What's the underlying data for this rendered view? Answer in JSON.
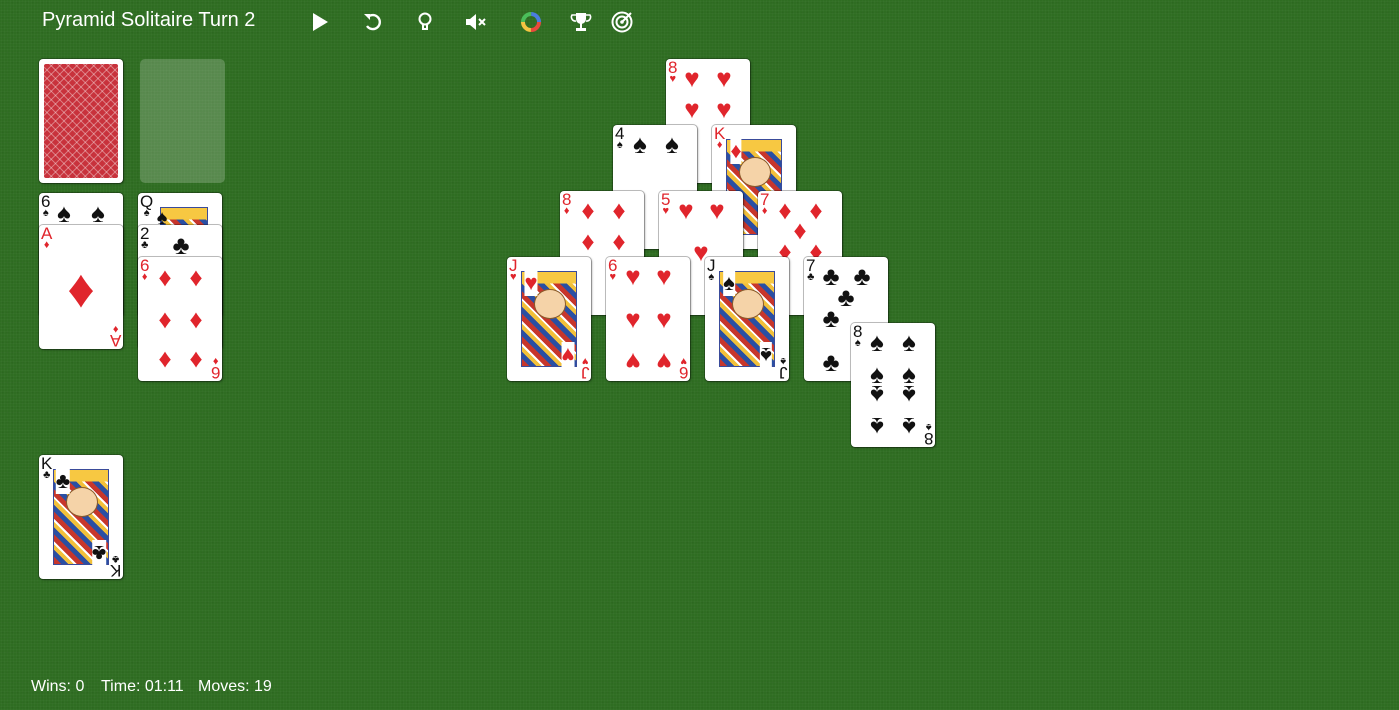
{
  "title": "Pyramid Solitaire Turn 2",
  "toolbar": [
    {
      "name": "play-icon"
    },
    {
      "name": "undo-icon"
    },
    {
      "name": "hint-bulb-icon"
    },
    {
      "name": "mute-icon"
    },
    {
      "name": "color-wheel-icon"
    },
    {
      "name": "trophy-icon"
    },
    {
      "name": "target-icon"
    }
  ],
  "colors": {
    "felt": "#2f6d22",
    "red": "#e0252c",
    "black": "#111111",
    "card_back": "#c8323c"
  },
  "stock": {
    "face_down": true
  },
  "waste": {
    "empty": true
  },
  "pyramid": [
    {
      "rank": "8",
      "suit": "♥",
      "color": "red"
    },
    {
      "rank": "4",
      "suit": "♠",
      "color": "black"
    },
    {
      "rank": "K",
      "suit": "♦",
      "color": "red"
    },
    {
      "rank": "8",
      "suit": "♦",
      "color": "red"
    },
    {
      "rank": "5",
      "suit": "♥",
      "color": "red"
    },
    {
      "rank": "7",
      "suit": "♦",
      "color": "red"
    },
    {
      "rank": "J",
      "suit": "♥",
      "color": "red"
    },
    {
      "rank": "6",
      "suit": "♥",
      "color": "red"
    },
    {
      "rank": "J",
      "suit": "♠",
      "color": "black"
    },
    {
      "rank": "7",
      "suit": "♣",
      "color": "black"
    },
    {
      "rank": "8",
      "suit": "♠",
      "color": "black"
    }
  ],
  "left_columns": [
    {
      "rank": "6",
      "suit": "♠",
      "color": "black"
    },
    {
      "rank": "A",
      "suit": "♦",
      "color": "red"
    },
    {
      "rank": "Q",
      "suit": "♠",
      "color": "black"
    },
    {
      "rank": "2",
      "suit": "♣",
      "color": "black"
    },
    {
      "rank": "6",
      "suit": "♦",
      "color": "red"
    }
  ],
  "foundation": {
    "rank": "K",
    "suit": "♣",
    "color": "black"
  },
  "status": {
    "wins": "Wins: 0",
    "time": "Time: 01:11",
    "moves": "Moves: 19"
  }
}
